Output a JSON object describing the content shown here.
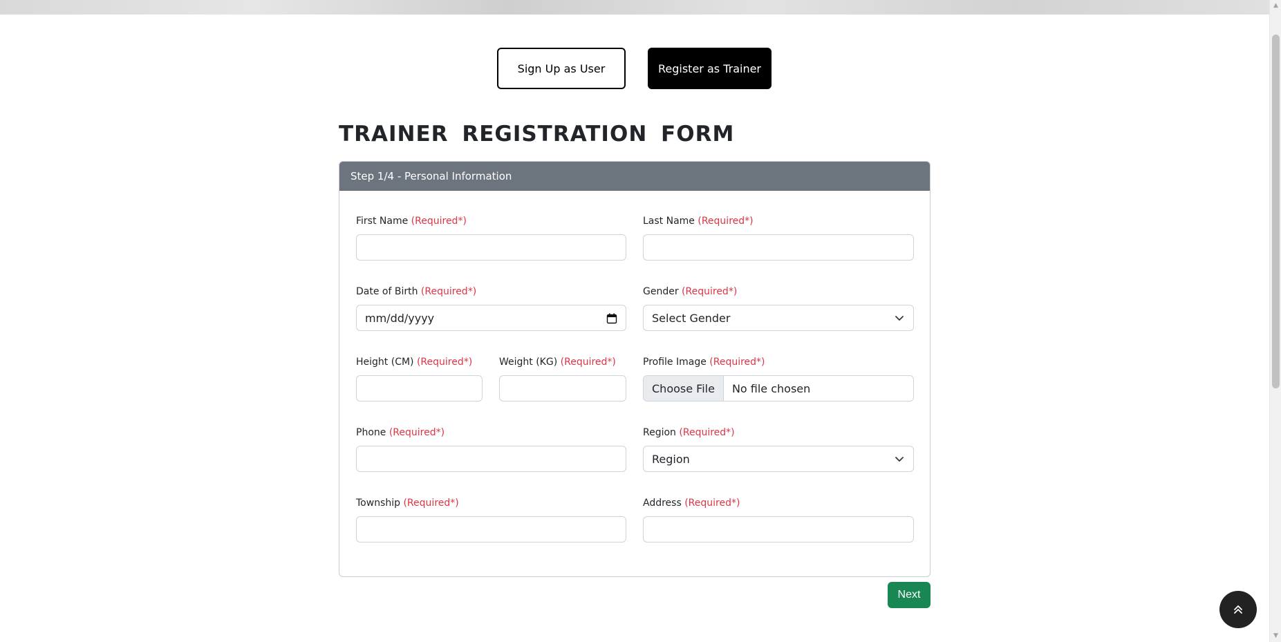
{
  "toggle": {
    "user_label": "Sign Up as User",
    "trainer_label": "Register as Trainer"
  },
  "form": {
    "title": "TRAINER REGISTRATION FORM",
    "step_header": "Step 1/4 - Personal Information",
    "required_marker": "(Required*)",
    "fields": {
      "first_name": {
        "label": "First Name",
        "value": ""
      },
      "last_name": {
        "label": "Last Name",
        "value": ""
      },
      "dob": {
        "label": "Date of Birth",
        "placeholder": "mm/dd/yyyy"
      },
      "gender": {
        "label": "Gender",
        "selected": "Select Gender"
      },
      "height": {
        "label": "Height (CM)",
        "value": ""
      },
      "weight": {
        "label": "Weight (KG)",
        "value": ""
      },
      "profile_image": {
        "label": "Profile Image",
        "button": "Choose File",
        "status": "No file chosen"
      },
      "phone": {
        "label": "Phone",
        "value": ""
      },
      "region": {
        "label": "Region",
        "selected": "Region"
      },
      "township": {
        "label": "Township",
        "value": ""
      },
      "address": {
        "label": "Address",
        "value": ""
      }
    },
    "next_label": "Next"
  },
  "icons": {
    "select_chevron": "chevron-down-icon",
    "calendar": "calendar-icon",
    "scroll_top": "double-chevron-up-icon"
  },
  "colors": {
    "header_bg": "#6c757d",
    "required": "#dc3545",
    "next_bg": "#198754",
    "trainer_btn_bg": "#000000",
    "fab_bg": "#222222"
  }
}
